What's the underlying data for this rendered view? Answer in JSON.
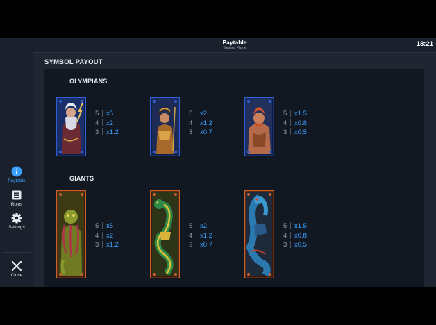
{
  "header": {
    "title": "Paytable",
    "subtitle": "Blessed Flame",
    "clock": "18:21"
  },
  "sidebar": {
    "items": [
      {
        "label": "Paytable",
        "icon": "info-icon",
        "active": true
      },
      {
        "label": "Rules",
        "icon": "rules-icon",
        "active": false
      },
      {
        "label": "Settings",
        "icon": "gear-icon",
        "active": false
      }
    ],
    "close_label": "Close"
  },
  "section_title": "SYMBOL PAYOUT",
  "groups": [
    {
      "title": "OLYMPIANS",
      "frame_color": "#2f5fd0",
      "symbols": [
        {
          "name": "zeus",
          "pays": [
            {
              "count": "5",
              "mult": "x5"
            },
            {
              "count": "4",
              "mult": "x2"
            },
            {
              "count": "3",
              "mult": "x1.2"
            }
          ]
        },
        {
          "name": "athena",
          "pays": [
            {
              "count": "5",
              "mult": "x2"
            },
            {
              "count": "4",
              "mult": "x1.2"
            },
            {
              "count": "3",
              "mult": "x0.7"
            }
          ]
        },
        {
          "name": "hephaestus",
          "pays": [
            {
              "count": "5",
              "mult": "x1.5"
            },
            {
              "count": "4",
              "mult": "x0.8"
            },
            {
              "count": "3",
              "mult": "x0.5"
            }
          ]
        }
      ]
    },
    {
      "title": "GIANTS",
      "frame_color": "#c9602a",
      "symbols": [
        {
          "name": "green-giant",
          "pays": [
            {
              "count": "5",
              "mult": "x5"
            },
            {
              "count": "4",
              "mult": "x2"
            },
            {
              "count": "3",
              "mult": "x1.2"
            }
          ]
        },
        {
          "name": "serpent-giant",
          "pays": [
            {
              "count": "5",
              "mult": "x2"
            },
            {
              "count": "4",
              "mult": "x1.2"
            },
            {
              "count": "3",
              "mult": "x0.7"
            }
          ]
        },
        {
          "name": "blue-giant",
          "pays": [
            {
              "count": "5",
              "mult": "x1.5"
            },
            {
              "count": "4",
              "mult": "x0.8"
            },
            {
              "count": "3",
              "mult": "x0.5"
            }
          ]
        }
      ]
    }
  ],
  "colors": {
    "accent": "#3aa0ff",
    "background": "#1f2632",
    "panel": "#121822"
  }
}
